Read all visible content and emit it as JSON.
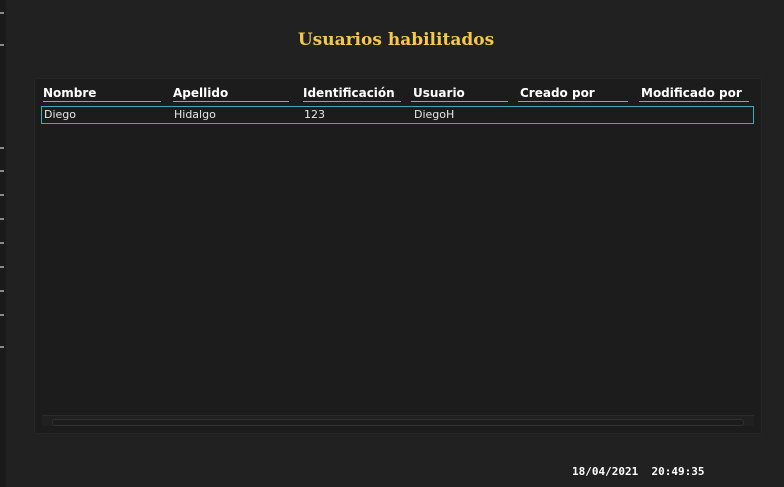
{
  "page": {
    "title": "Usuarios habilitados",
    "title_color": "#f2c94c"
  },
  "grid": {
    "columns": [
      "Nombre",
      "Apellido",
      "Identificación",
      "Usuario",
      "Creado por",
      "Modificado por"
    ],
    "rows": [
      {
        "nombre": "Diego",
        "apellido": "Hidalgo",
        "identificacion": "123",
        "usuario": "DiegoH",
        "creado_por": "",
        "modificado_por": ""
      }
    ],
    "selected_row_border": "#3aa9c0"
  },
  "status": {
    "date": "18/04/2021",
    "time": "20:49:35"
  }
}
